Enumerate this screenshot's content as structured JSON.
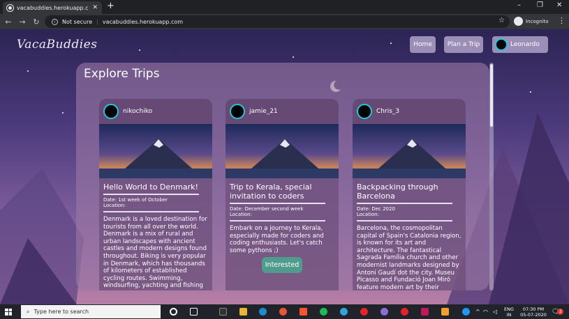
{
  "browser": {
    "tab_title": "vacabuddies.herokuapp.com",
    "new_tab_glyph": "+",
    "security_label": "Not secure",
    "url": "vacabuddies.herokuapp.com",
    "incognito_label": "Incognito"
  },
  "site": {
    "brand": "VacaBuddies",
    "nav": {
      "home": "Home",
      "plan": "Plan a Trip",
      "user": "Leonardo"
    },
    "panel_title": "Explore Trips"
  },
  "trips": [
    {
      "user": "nikochiko",
      "title": "Hello World to Denmark!",
      "date": "Date: 1st week of October",
      "location": "Location:",
      "description": "Denmark is a loved destination for tourists from all over the world. Denmark is a mix of rural and urban landscapes with ancient castles and modern designs found throughout. Biking is very popular in Denmark, which has thousands of kilometers of established cycling routes. Swimming, windsurfing, yachting and fishing"
    },
    {
      "user": "jamie_21",
      "title": "Trip to Kerala, special invitation to coders",
      "date": "Date: December second week",
      "location": "Location:",
      "description": "Embark on a journey to Kerala, especially made for coders and coding enthusiasts. Let's catch some pythons ;)",
      "button": "Interested"
    },
    {
      "user": "Chris_3",
      "title": "Backpacking through Barcelona",
      "date": "Date: Dec 2020",
      "location": "Location:",
      "description": "Barcelona, the cosmopolitan capital of Spain's Catalonia region, is known for its art and architecture. The fantastical Sagrada Família church and other modernist landmarks designed by Antoni Gaudí dot the city. Museu Picasso and Fundació Joan Miró feature modern art by their"
    }
  ],
  "taskbar": {
    "search_placeholder": "Type here to search",
    "lang_top": "ENG",
    "lang_bottom": "IN",
    "time": "07:30 PM",
    "date": "05-07-2020",
    "notification_count": "2"
  },
  "colors": {
    "accent_button": "#4f9c8f",
    "nav_button": "#9c8fb7",
    "avatar_ring": "#1ec9e0"
  }
}
